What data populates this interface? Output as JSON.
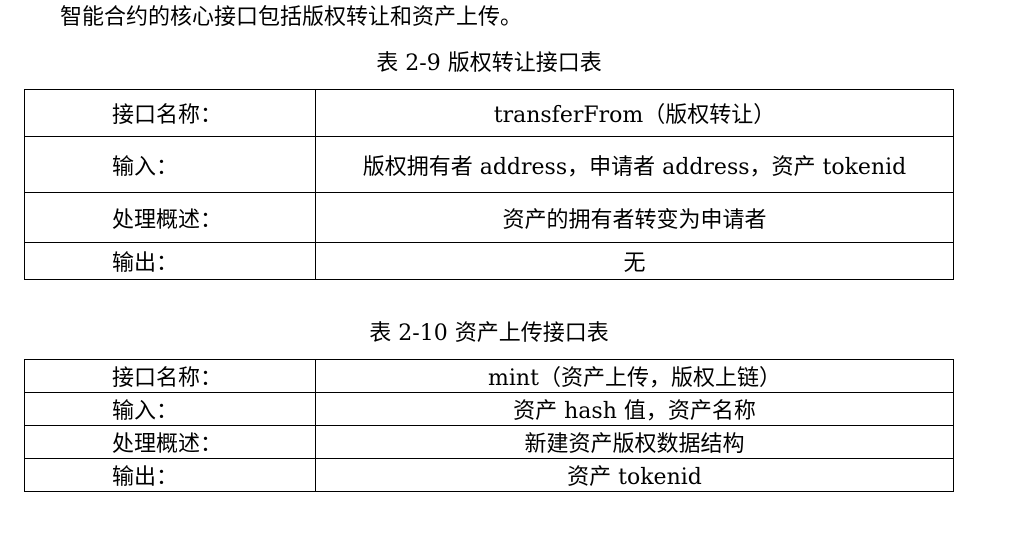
{
  "intro_text": "智能合约的核心接口包括版权转让和资产上传。",
  "tables": [
    {
      "caption": "表 2-9 版权转让接口表",
      "rows": [
        {
          "label": "接口名称：",
          "value": "transferFrom（版权转让）"
        },
        {
          "label": "输入：",
          "value": "版权拥有者 address，申请者 address，资产 tokenid"
        },
        {
          "label": "处理概述：",
          "value": "资产的拥有者转变为申请者"
        },
        {
          "label": "输出：",
          "value": "无"
        }
      ]
    },
    {
      "caption": "表 2-10 资产上传接口表",
      "rows": [
        {
          "label": "接口名称：",
          "value": "mint（资产上传，版权上链）"
        },
        {
          "label": "输入：",
          "value": "资产 hash 值，资产名称"
        },
        {
          "label": "处理概述：",
          "value": "新建资产版权数据结构"
        },
        {
          "label": "输出：",
          "value": "资产 tokenid"
        }
      ]
    }
  ]
}
